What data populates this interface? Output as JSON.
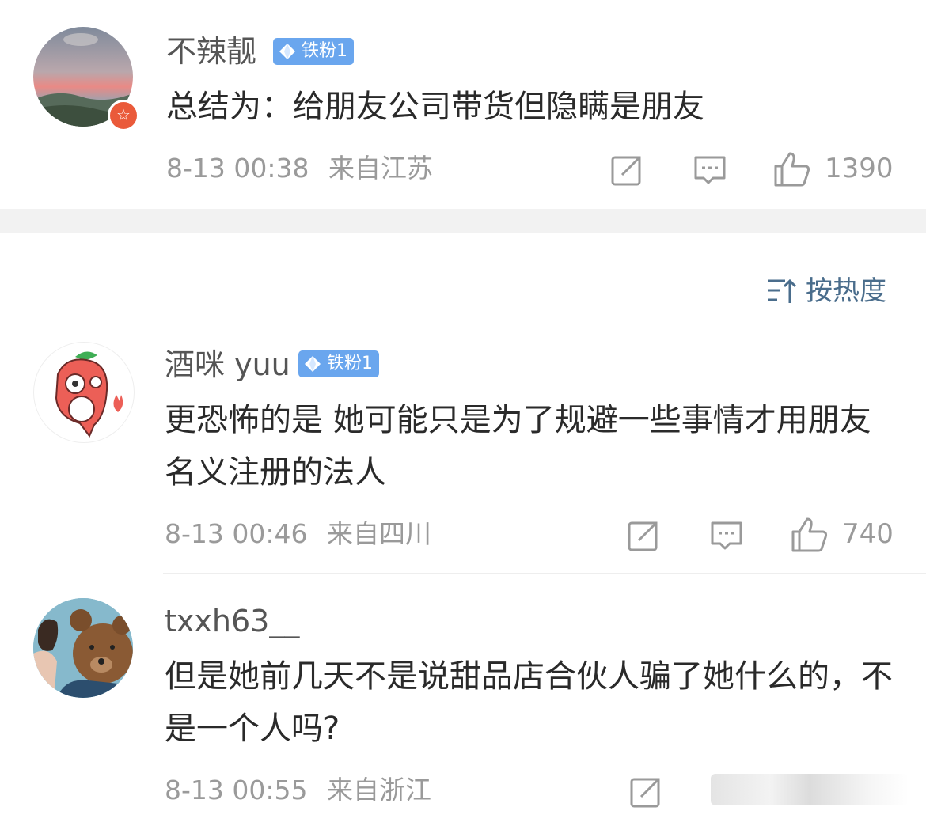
{
  "comments": [
    {
      "username": "不辣靓",
      "badge": "铁粉1",
      "text": "总结为：给朋友公司带货但隐瞒是朋友",
      "time": "8-13 00:38",
      "location": "来自江苏",
      "likes": "1390",
      "avatar_icon": "landscape-sunset-avatar",
      "verified_icon": "star-badge-icon"
    },
    {
      "username": "酒咪 yuu",
      "badge": "铁粉1",
      "text": "更恐怖的是 她可能只是为了规避一些事情才用朋友名义注册的法人",
      "time": "8-13 00:46",
      "location": "来自四川",
      "likes": "740",
      "avatar_icon": "chili-cartoon-avatar"
    },
    {
      "username": "txxh63__",
      "text": "但是她前几天不是说甜品店合伙人骗了她什么的，不是一个人吗?",
      "time": "8-13 00:55",
      "location": "来自浙江",
      "avatar_icon": "teddy-bear-avatar"
    }
  ],
  "sort_label": "按热度",
  "colors": {
    "badge": "#6aa6ee",
    "sort": "#4a6d8c",
    "meta": "#9a9a9a",
    "verified": "#ea5a3a"
  }
}
